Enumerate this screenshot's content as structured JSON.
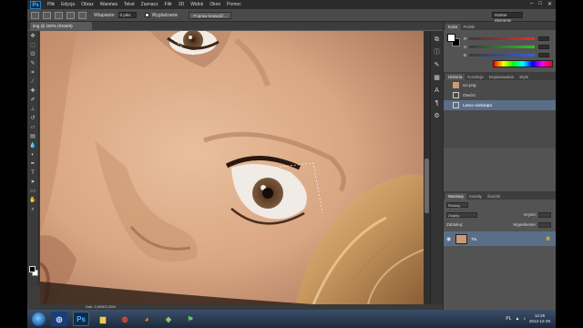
{
  "menubar": {
    "logo": "Ps",
    "items": [
      "Plik",
      "Edycja",
      "Obraz",
      "Warstwa",
      "Tekst",
      "Zaznacz",
      "Filtr",
      "3D",
      "Widok",
      "Okno",
      "Pomoc"
    ],
    "window_controls": [
      "–",
      "□",
      "✕"
    ]
  },
  "options_bar": {
    "feather_label": "Wtapianie:",
    "feather_value": "0 piks",
    "antialias_label": "Wygładzanie",
    "refine_button": "Popraw krawędź...",
    "workspace": "Istotne elementy"
  },
  "document": {
    "tab_title": "img @ 200% (RGB/8)",
    "status": "Dok: 2,92M/2,92M"
  },
  "tools": [
    "move",
    "marquee",
    "lasso",
    "quick-select",
    "crop",
    "eyedropper",
    "healing",
    "brush",
    "clone",
    "history-brush",
    "eraser",
    "gradient",
    "blur",
    "dodge",
    "pen",
    "type",
    "path-select",
    "shape",
    "hand",
    "zoom"
  ],
  "panels": {
    "color": {
      "tabs": [
        "Kolor",
        "Próbki"
      ],
      "slider_labels": [
        "R",
        "G",
        "B"
      ],
      "colors": {
        "red": "#e03030",
        "green": "#30c030",
        "blue": "#3060e0"
      }
    },
    "history": {
      "tabs": [
        "Historia",
        "Korekcje",
        "Dopasowania",
        "Style"
      ],
      "items": [
        {
          "label": "scr.png",
          "kind": "snapshot"
        },
        {
          "label": "Otwórz",
          "kind": "step"
        },
        {
          "label": "Lasso wielokąta",
          "kind": "step",
          "selected": true
        }
      ]
    },
    "layers": {
      "tabs": [
        "Warstwy",
        "Kanały",
        "Ścieżki"
      ],
      "filter": "Rodzaj",
      "blend_mode": "Zwykły",
      "opacity_label": "Krycie:",
      "lock_label": "Zablokuj:",
      "fill_label": "Wypełnienie:",
      "items": [
        {
          "name": "Tło",
          "locked": true
        }
      ]
    }
  },
  "taskbar": {
    "apps": [
      "windows-explorer-icon",
      "photoshop-icon",
      "folder-icon",
      "chrome-icon",
      "firefox-icon",
      "app-icon",
      "flag-icon"
    ],
    "language": "PL",
    "clock_time": "12:25",
    "clock_date": "2012-12-29"
  }
}
